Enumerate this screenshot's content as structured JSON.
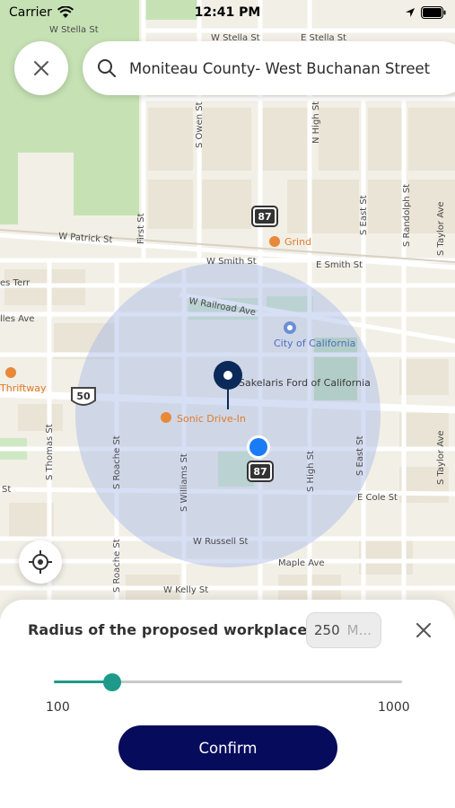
{
  "status_bar": {
    "carrier": "Carrier",
    "time": "12:41 PM",
    "icons": [
      "wifi-icon",
      "location-arrow-icon",
      "battery-icon"
    ]
  },
  "search": {
    "query": "Moniteau County- West Buchanan Street",
    "icon": "search-icon"
  },
  "map": {
    "streets": {
      "w_stella_1": "W Stella St",
      "w_stella_2": "W Stella St",
      "e_stella": "E Stella St",
      "w_patrick": "W Patrick St",
      "w_smith": "W Smith St",
      "e_smith": "E Smith St",
      "w_railroad": "W Railroad Ave",
      "es_terr": "es Terr",
      "lles_ave": "lles Ave",
      "w_russell": "W Russell St",
      "maple_ave": "Maple Ave",
      "w_kelly": "W Kelly St",
      "e_cole": "E Cole St",
      "st_left": "St",
      "s_owen": "S Owen St",
      "n_high": "N High St",
      "first_st": "First St",
      "s_east": "S East St",
      "s_randolph": "S Randolph St",
      "s_taylor_1": "S Taylor Ave",
      "s_taylor_2": "S Taylor Ave",
      "s_thomas": "S Thomas St",
      "s_roache_1": "S Roache St",
      "s_roache_2": "S Roache St",
      "s_williams": "S Williams St",
      "s_high": "S High St",
      "s_east_2": "S East St"
    },
    "pois": {
      "grind": "Grind",
      "city_hall": "City of California",
      "sakelaris": "Sakelaris Ford of California",
      "sonic": "Sonic Drive-In",
      "thriftway": "Thriftway"
    },
    "route_shields": {
      "route_87_top": "87",
      "route_87_bottom": "87",
      "route_50": "50"
    },
    "colors": {
      "radius_circle": "#9fb2e8",
      "user_dot": "#1a7cf5",
      "pin": "#0b2a5a",
      "poi_orange": "#e8893a",
      "park_green": "#c5e3b7"
    }
  },
  "sheet": {
    "title": "Radius of the proposed workplace",
    "radius_value": "250",
    "radius_unit": "M...",
    "slider_min": "100",
    "slider_max": "1000",
    "slider_value": 250,
    "confirm_label": "Confirm"
  }
}
